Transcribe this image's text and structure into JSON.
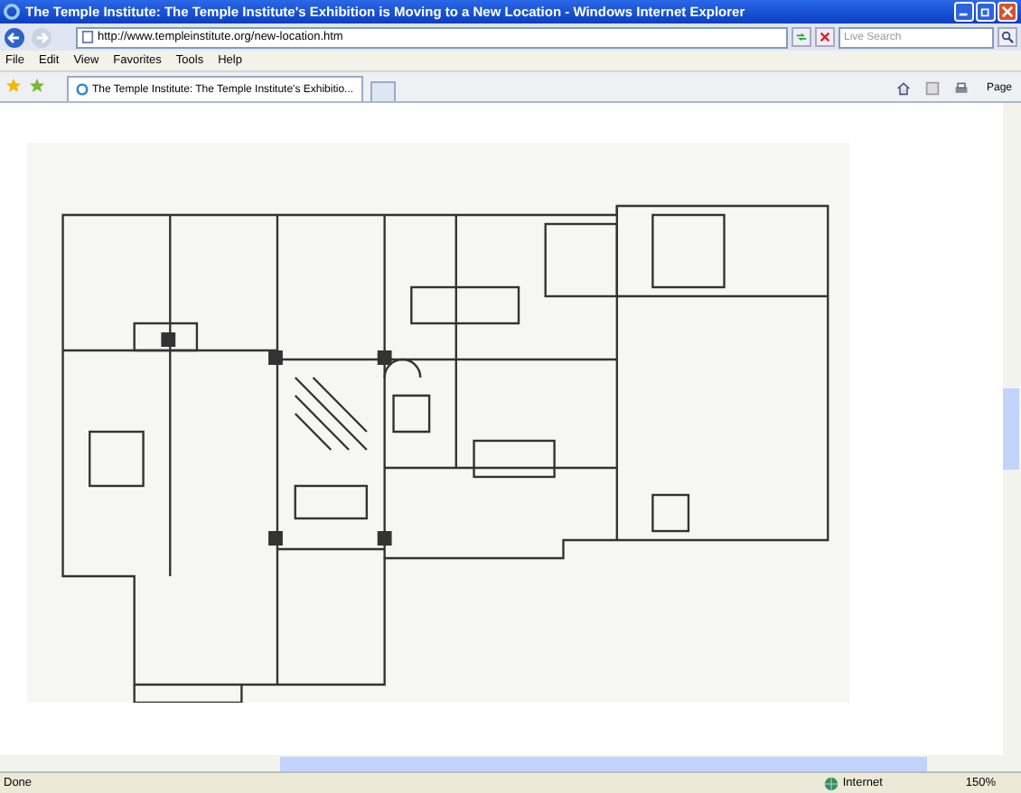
{
  "window": {
    "title": "The Temple Institute: The Temple Institute's Exhibition is Moving to a New Location - Windows Internet Explorer"
  },
  "address_bar": {
    "url": "http://www.templeinstitute.org/new-location.htm"
  },
  "search": {
    "placeholder": "Live Search"
  },
  "menu": [
    "File",
    "Edit",
    "View",
    "Favorites",
    "Tools",
    "Help"
  ],
  "tabs": [
    {
      "label": "The Temple Institute: The Temple Institute's Exhibitio...",
      "selected": true
    }
  ],
  "toolbar": {
    "page_button": "Page"
  },
  "status_bar": {
    "status": "Done",
    "zone": "Internet",
    "zoom": "150%"
  }
}
